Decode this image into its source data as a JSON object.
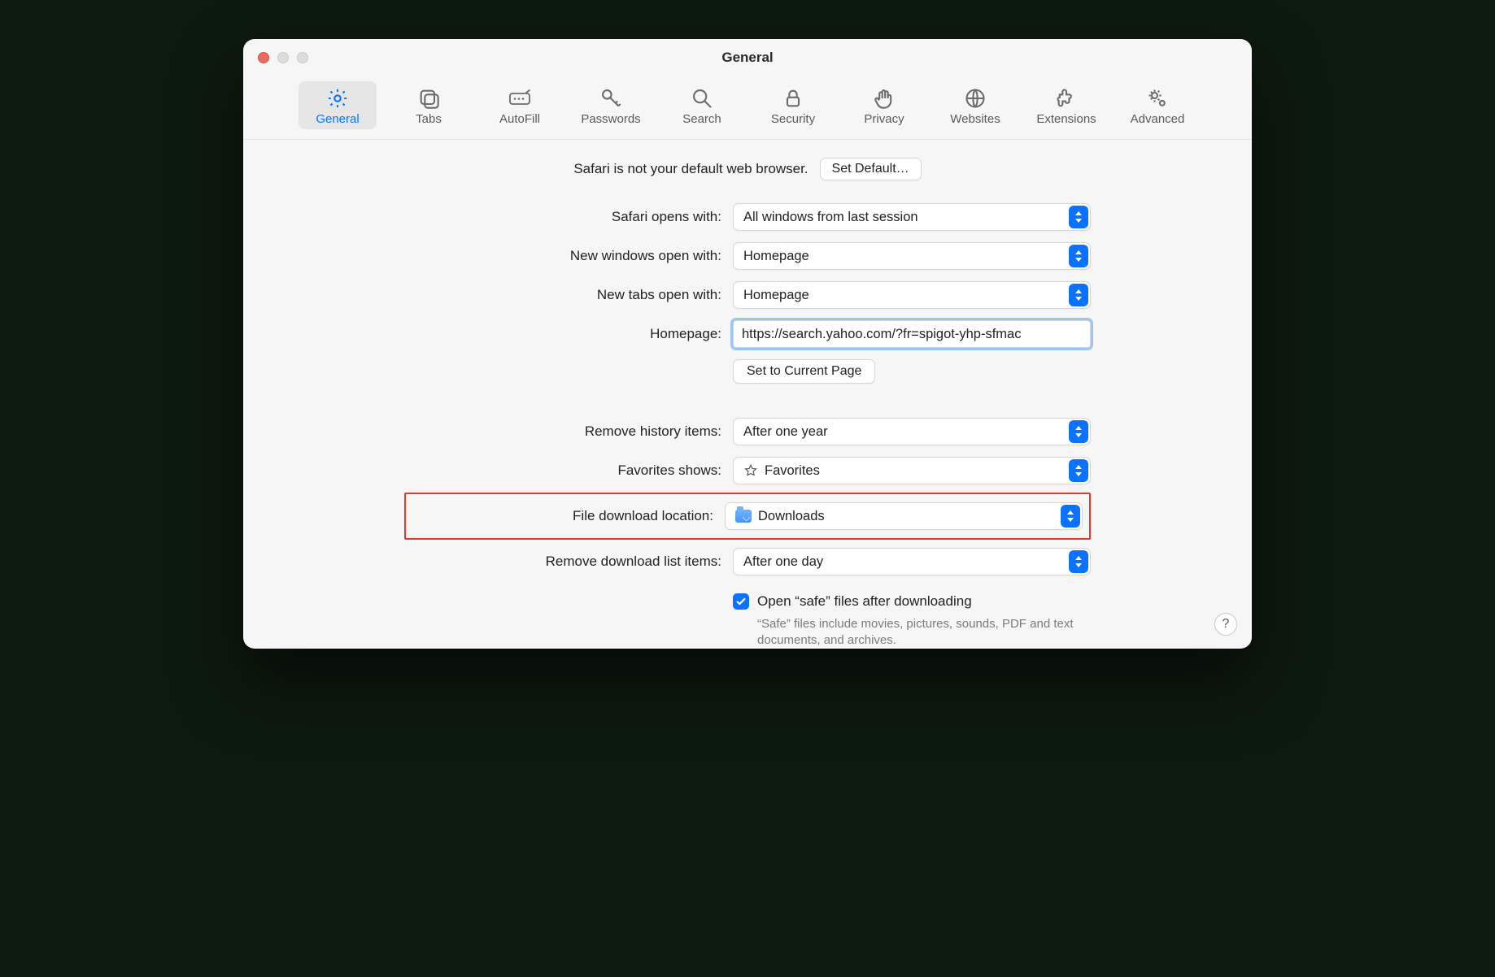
{
  "window": {
    "title": "General"
  },
  "traffic": {
    "close": "close",
    "min": "minimize",
    "max": "maximize"
  },
  "tabs": [
    {
      "id": "general",
      "label": "General"
    },
    {
      "id": "tabs",
      "label": "Tabs"
    },
    {
      "id": "autofill",
      "label": "AutoFill"
    },
    {
      "id": "passwords",
      "label": "Passwords"
    },
    {
      "id": "search",
      "label": "Search"
    },
    {
      "id": "security",
      "label": "Security"
    },
    {
      "id": "privacy",
      "label": "Privacy"
    },
    {
      "id": "websites",
      "label": "Websites"
    },
    {
      "id": "extensions",
      "label": "Extensions"
    },
    {
      "id": "advanced",
      "label": "Advanced"
    }
  ],
  "defaultBrowser": {
    "message": "Safari is not your default web browser.",
    "button": "Set Default…"
  },
  "labels": {
    "opensWith": "Safari opens with:",
    "newWindows": "New windows open with:",
    "newTabs": "New tabs open with:",
    "homepage": "Homepage:",
    "setCurrent": "Set to Current Page",
    "removeHistory": "Remove history items:",
    "favorites": "Favorites shows:",
    "downloadLoc": "File download location:",
    "removeDownloads": "Remove download list items:",
    "openSafe": "Open “safe” files after downloading",
    "safeHint": "“Safe” files include movies, pictures, sounds, PDF and text documents, and archives."
  },
  "values": {
    "opensWith": "All windows from last session",
    "newWindows": "Homepage",
    "newTabs": "Homepage",
    "homepage": "https://search.yahoo.com/?fr=spigot-yhp-sfmac",
    "removeHistory": "After one year",
    "favorites": "Favorites",
    "downloadLoc": "Downloads",
    "removeDownloads": "After one day"
  },
  "help": "?"
}
